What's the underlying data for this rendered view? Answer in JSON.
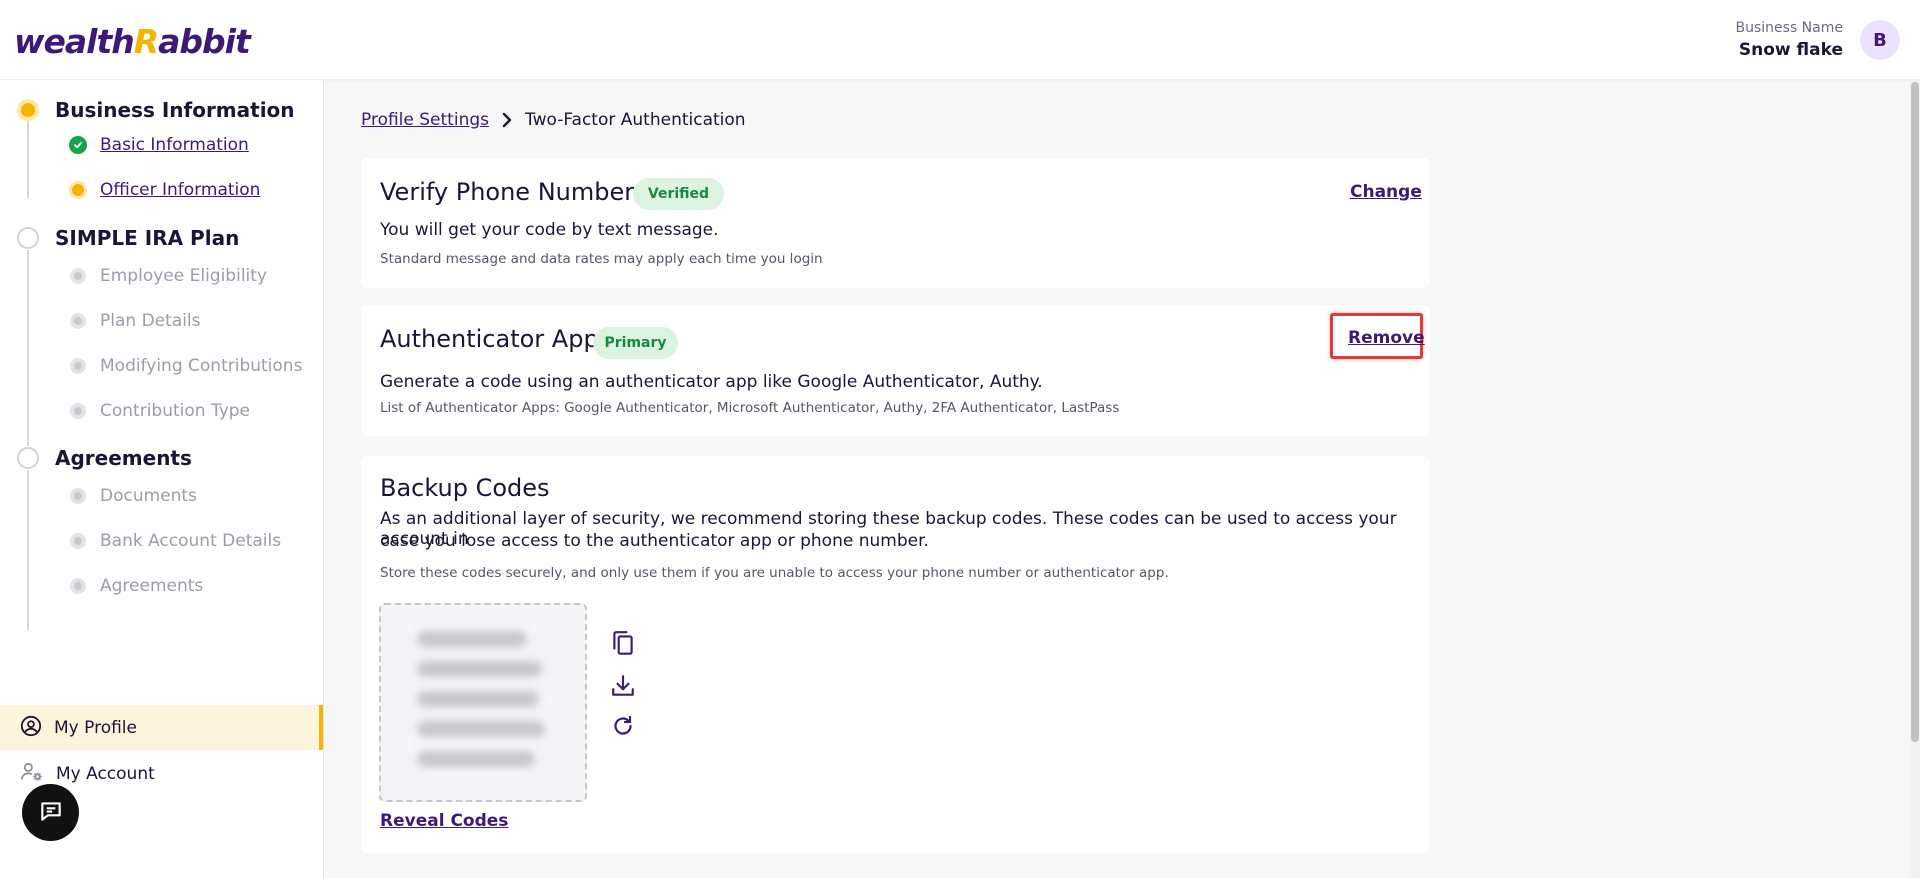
{
  "header": {
    "logo_prefix": "wealth",
    "logo_r": "R",
    "logo_suffix": "abbit",
    "business_label": "Business Name",
    "business_name": "Snow flake",
    "avatar_initial": "B"
  },
  "sidebar": {
    "sections": [
      {
        "title": "Business Information",
        "status": "in-progress",
        "items": [
          {
            "label": "Basic Information",
            "status": "complete"
          },
          {
            "label": "Officer Information",
            "status": "in-progress"
          }
        ]
      },
      {
        "title": "SIMPLE IRA Plan",
        "status": "pending",
        "items": [
          {
            "label": "Employee Eligibility",
            "status": "pending"
          },
          {
            "label": "Plan Details",
            "status": "pending"
          },
          {
            "label": "Modifying Contributions",
            "status": "pending"
          },
          {
            "label": "Contribution Type",
            "status": "pending"
          }
        ]
      },
      {
        "title": "Agreements",
        "status": "pending",
        "items": [
          {
            "label": "Documents",
            "status": "pending"
          },
          {
            "label": "Bank Account Details",
            "status": "pending"
          },
          {
            "label": "Agreements",
            "status": "pending"
          }
        ]
      }
    ],
    "nav": {
      "my_profile": "My Profile",
      "my_account": "My Account"
    }
  },
  "breadcrumb": {
    "parent": "Profile Settings",
    "current": "Two-Factor Authentication"
  },
  "phone_card": {
    "title": "Verify Phone Number",
    "badge": "Verified",
    "action": "Change",
    "description": "You will get your code by text message.",
    "note": "Standard message and data rates may apply each time you login"
  },
  "auth_card": {
    "title": "Authenticator App",
    "badge": "Primary",
    "action": "Remove",
    "description": "Generate a code using an authenticator app like Google Authenticator, Authy.",
    "note": "List of Authenticator Apps: Google Authenticator, Microsoft Authenticator, Authy, 2FA Authenticator, LastPass"
  },
  "backup_card": {
    "title": "Backup Codes",
    "description_line1": "As an additional layer of security, we recommend storing these backup codes. These codes can be used to access your account in",
    "description_line2": "case you lose access to the authenticator app or phone number.",
    "note": "Store these codes securely, and only use them if you are unable to access your phone number or authenticator app.",
    "reveal_label": "Reveal Codes",
    "codes_hidden": true,
    "code_count": 5,
    "icons": [
      "copy-icon",
      "download-icon",
      "refresh-icon"
    ]
  },
  "colors": {
    "brand": "#3d1a78",
    "accent": "#f4b400",
    "success": "#16a34a",
    "badge_bg": "#dcf3e2",
    "highlight_border": "#e53935"
  }
}
